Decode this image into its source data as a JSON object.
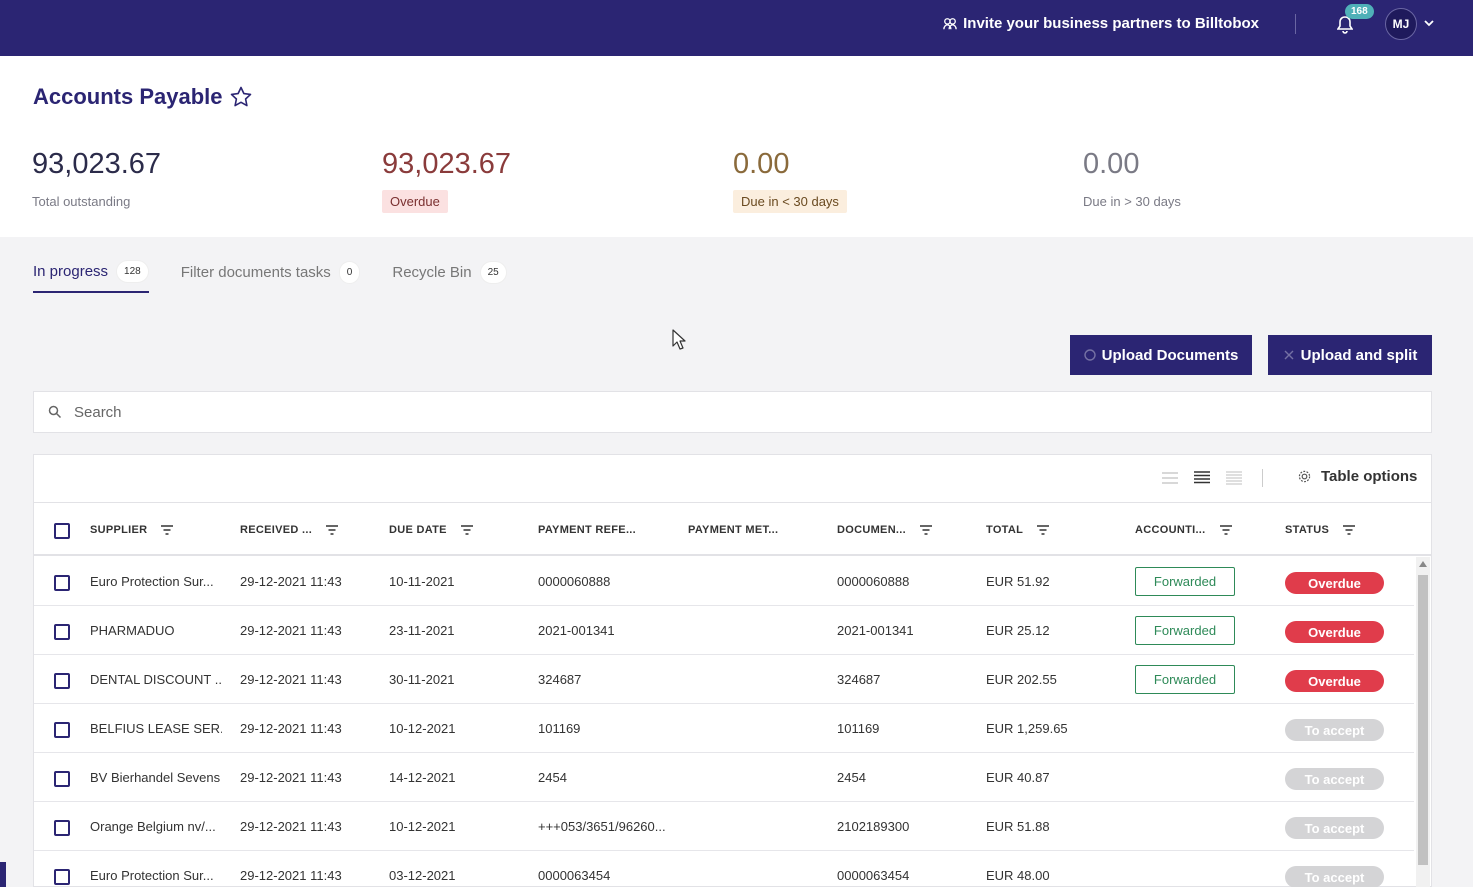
{
  "topbar": {
    "invite_text": "Invite your business partners to Billtobox",
    "notification_count": "168",
    "user_initials": "MJ"
  },
  "page": {
    "title": "Accounts Payable"
  },
  "stats": [
    {
      "value": "93,023.67",
      "label": "Total outstanding"
    },
    {
      "value": "93,023.67",
      "label": "Overdue"
    },
    {
      "value": "0.00",
      "label": "Due in < 30 days"
    },
    {
      "value": "0.00",
      "label": "Due in > 30 days"
    }
  ],
  "tabs": [
    {
      "label": "In progress",
      "count": "128",
      "active": true
    },
    {
      "label": "Filter documents tasks",
      "count": "0",
      "active": false
    },
    {
      "label": "Recycle Bin",
      "count": "25",
      "active": false
    }
  ],
  "actions": {
    "upload_label": "Upload Documents",
    "split_label": "Upload and split"
  },
  "search": {
    "placeholder": "Search"
  },
  "table": {
    "options_label": "Table options",
    "columns": [
      "SUPPLIER",
      "RECEIVED ...",
      "DUE DATE",
      "PAYMENT REFE...",
      "PAYMENT MET...",
      "DOCUMEN...",
      "TOTAL",
      "ACCOUNTI...",
      "STATUS"
    ],
    "rows": [
      {
        "supplier": "Euro Protection Sur...",
        "received": "29-12-2021 11:43",
        "due": "10-11-2021",
        "payref": "0000060888",
        "paymet": "",
        "doc": "0000060888",
        "total": "EUR 51.92",
        "accounting": "Forwarded",
        "status": "Overdue"
      },
      {
        "supplier": "PHARMADUO",
        "received": "29-12-2021 11:43",
        "due": "23-11-2021",
        "payref": "2021-001341",
        "paymet": "",
        "doc": "2021-001341",
        "total": "EUR 25.12",
        "accounting": "Forwarded",
        "status": "Overdue"
      },
      {
        "supplier": "DENTAL DISCOUNT ...",
        "received": "29-12-2021 11:43",
        "due": "30-11-2021",
        "payref": "324687",
        "paymet": "",
        "doc": "324687",
        "total": "EUR 202.55",
        "accounting": "Forwarded",
        "status": "Overdue"
      },
      {
        "supplier": "BELFIUS LEASE SER...",
        "received": "29-12-2021 11:43",
        "due": "10-12-2021",
        "payref": "101169",
        "paymet": "",
        "doc": "101169",
        "total": "EUR 1,259.65",
        "accounting": "",
        "status": "To accept"
      },
      {
        "supplier": "BV Bierhandel Sevens",
        "received": "29-12-2021 11:43",
        "due": "14-12-2021",
        "payref": "2454",
        "paymet": "",
        "doc": "2454",
        "total": "EUR 40.87",
        "accounting": "",
        "status": "To accept"
      },
      {
        "supplier": "Orange Belgium nv/...",
        "received": "29-12-2021 11:43",
        "due": "10-12-2021",
        "payref": "+++053/3651/96260...",
        "paymet": "",
        "doc": "2102189300",
        "total": "EUR 51.88",
        "accounting": "",
        "status": "To accept"
      },
      {
        "supplier": "Euro Protection Sur...",
        "received": "29-12-2021 11:43",
        "due": "03-12-2021",
        "payref": "0000063454",
        "paymet": "",
        "doc": "0000063454",
        "total": "EUR 48.00",
        "accounting": "",
        "status": "To accept"
      }
    ]
  },
  "colors": {
    "brand": "#2b2573",
    "overdue": "#e03c4b",
    "forwarded": "#2e8a58",
    "notification": "#4fb0b8"
  }
}
